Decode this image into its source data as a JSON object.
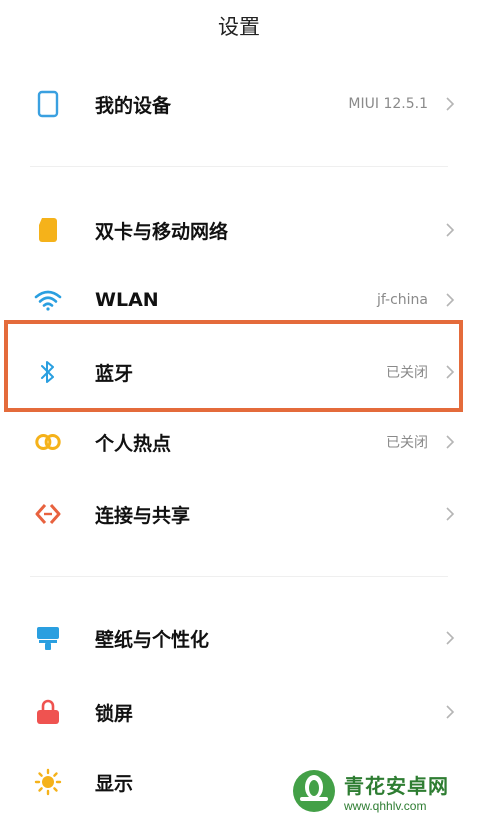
{
  "header": {
    "title": "设置"
  },
  "sections": [
    {
      "items": [
        {
          "label": "我的设备",
          "value": "MIUI 12.5.1",
          "icon": "phone-icon"
        }
      ]
    },
    {
      "items": [
        {
          "label": "双卡与移动网络",
          "value": "",
          "icon": "sim-card-icon"
        },
        {
          "label": "WLAN",
          "value": "jf-china",
          "icon": "wifi-icon"
        },
        {
          "label": "蓝牙",
          "value": "已关闭",
          "icon": "bluetooth-icon"
        },
        {
          "label": "个人热点",
          "value": "已关闭",
          "icon": "hotspot-icon"
        },
        {
          "label": "连接与共享",
          "value": "",
          "icon": "share-connection-icon"
        }
      ]
    },
    {
      "items": [
        {
          "label": "壁纸与个性化",
          "value": "",
          "icon": "wallpaper-icon"
        },
        {
          "label": "锁屏",
          "value": "",
          "icon": "lock-icon"
        },
        {
          "label": "显示",
          "value": "",
          "icon": "sun-icon"
        }
      ]
    }
  ],
  "watermark": {
    "name": "青花安卓网",
    "url": "www.qhhlv.com"
  },
  "colors": {
    "highlight": "#e46b3b",
    "phone": "#3aa0e0",
    "sim": "#f5b21a",
    "wifi": "#2a9fe0",
    "bluetooth": "#2a9fe0",
    "hotspot": "#f5b21a",
    "share": "#e8623f",
    "wallpaper": "#2a9fe0",
    "lock": "#ef5350",
    "sun": "#f5b21a"
  }
}
